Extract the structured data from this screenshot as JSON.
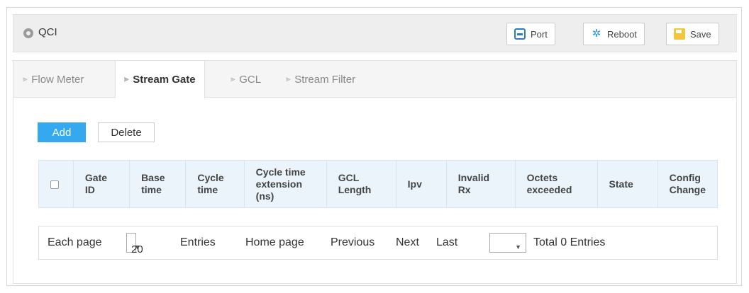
{
  "header": {
    "title": "QCI",
    "buttons": {
      "port": "Port",
      "reboot": "Reboot",
      "save": "Save"
    }
  },
  "tabs": [
    {
      "label": "Flow Meter",
      "active": false
    },
    {
      "label": "Stream Gate",
      "active": true
    },
    {
      "label": "GCL",
      "active": false
    },
    {
      "label": "Stream Filter",
      "active": false
    }
  ],
  "actions": {
    "add": "Add",
    "delete": "Delete"
  },
  "table": {
    "columns": [
      [
        "Gate",
        "ID"
      ],
      [
        "Base",
        "time"
      ],
      [
        "Cycle",
        "time"
      ],
      [
        "Cycle time",
        "extension",
        "(ns)"
      ],
      [
        "GCL",
        "Length"
      ],
      [
        "Ipv"
      ],
      [
        "Invalid",
        "Rx"
      ],
      [
        "Octets",
        "exceeded"
      ],
      [
        "State"
      ],
      [
        "Config",
        "Change"
      ]
    ],
    "rows": []
  },
  "pager": {
    "each_page": "Each page",
    "page_size": "20",
    "entries": "Entries",
    "home": "Home page",
    "previous": "Previous",
    "next": "Next",
    "last": "Last",
    "jump_value": "",
    "total": "Total 0 Entries"
  },
  "colors": {
    "accent": "#35a9f0",
    "header_bg": "#eaf4fa",
    "titlebar_bg": "#eeeeee"
  }
}
